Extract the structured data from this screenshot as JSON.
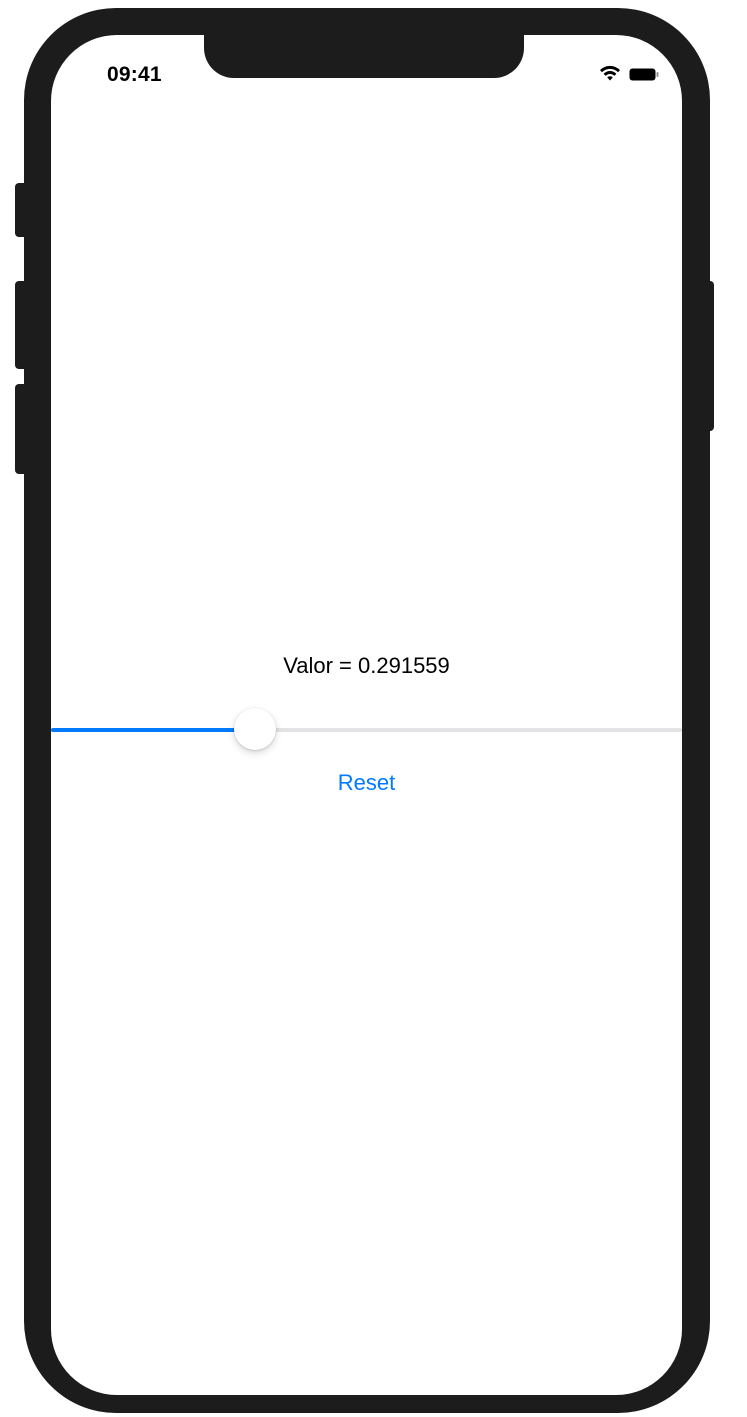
{
  "status_bar": {
    "time": "09:41",
    "wifi_icon": "wifi-icon",
    "battery_icon": "battery-icon"
  },
  "content": {
    "value_label": "Valor = 0.291559",
    "slider": {
      "value": 0.291559,
      "min": 0,
      "max": 1,
      "fill_color": "#007aff",
      "track_color": "#e3e3e6"
    },
    "reset_label": "Reset"
  },
  "colors": {
    "accent": "#007aff",
    "frame": "#1c1c1c",
    "background": "#ffffff"
  }
}
